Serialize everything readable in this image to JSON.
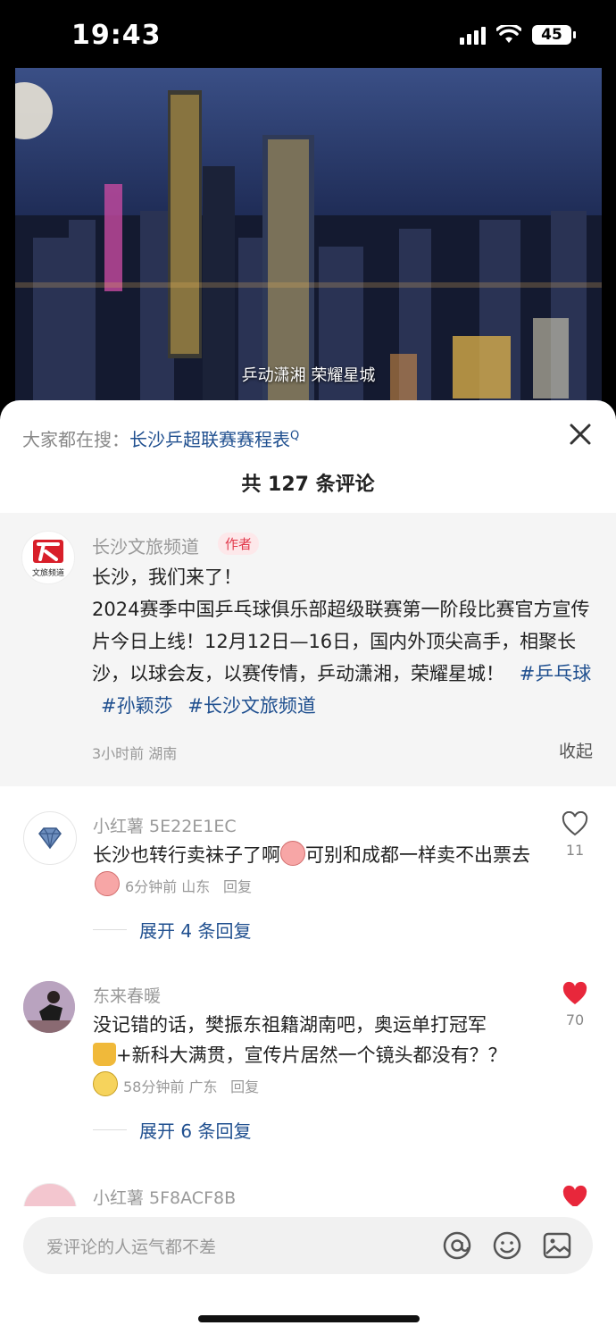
{
  "status": {
    "time": "19:43",
    "battery": "45"
  },
  "video": {
    "caption": "乒动潇湘 荣耀星城"
  },
  "search": {
    "prefix": "大家都在搜：",
    "keyword": "长沙乒超联赛赛程表",
    "q_mark": "Q"
  },
  "comments_header": {
    "title": "共 127 条评论"
  },
  "author_post": {
    "name": "长沙文旅频道",
    "tag": "作者",
    "text": "长沙，我们来了！\n2024赛季中国乒乓球俱乐部超级联赛第一阶段比赛官方宣传片今日上线！12月12日—16日，国内外顶尖高手，相聚长沙，以球会友，以赛传情，乒动潇湘，荣耀星城！",
    "hashtags": [
      "#乒乓球",
      "#孙颖莎",
      "#长沙文旅频道"
    ],
    "meta": "3小时前 湖南",
    "collapse": "收起",
    "avatar_text": "文旅频道"
  },
  "comments": [
    {
      "name": "小红薯 5E22E1EC",
      "text_a": "长沙也转行卖袜子了啊",
      "text_b": "可别和成都一样卖不出票去",
      "meta": "6分钟前 山东",
      "reply": "回复",
      "likes": "11",
      "liked": false,
      "expand": "展开 4 条回复"
    },
    {
      "name": "东来春暖",
      "text_a": "没记错的话，樊振东祖籍湖南吧，奥运单打冠军",
      "text_b": "+新科大满贯，宣传片居然一个镜头都没有？？",
      "meta": "58分钟前 广东",
      "reply": "回复",
      "likes": "70",
      "liked": true,
      "expand": "展开 6 条回复"
    },
    {
      "name": "小红薯 5F8ACF8B",
      "liked": true
    }
  ],
  "input": {
    "placeholder": "爱评论的人运气都不差"
  },
  "colors": {
    "link": "#1f4f8f",
    "like_red": "#e8273b",
    "author_bg": "#f5f5f5"
  }
}
